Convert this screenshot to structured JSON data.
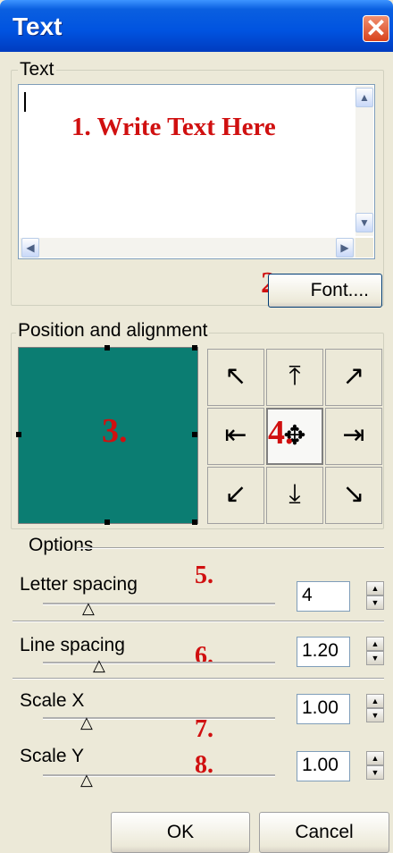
{
  "window": {
    "title": "Text",
    "close_glyph": "✕"
  },
  "text_group": {
    "label": "Text",
    "annotation": "1. Write Text Here",
    "font_button": "Font....",
    "font_marker": "2."
  },
  "position_group": {
    "label": "Position and alignment",
    "preview_marker": "3.",
    "grid_marker": "4.",
    "preview_color": "#0b7d72",
    "alignment_glyphs": [
      "↖",
      "⤒",
      "↗",
      "⇤",
      "✥",
      "⇥",
      "↙",
      "⤓",
      "↘"
    ]
  },
  "options_group": {
    "label": "Options",
    "letter_spacing": {
      "label": "Letter spacing",
      "value": "4",
      "marker": "5."
    },
    "line_spacing": {
      "label": "Line spacing",
      "value": "1.20",
      "marker": "6."
    },
    "scale_x": {
      "label": "Scale X",
      "value": "1.00",
      "marker": "7."
    },
    "scale_y": {
      "label": "Scale Y",
      "value": "1.00",
      "marker": "8."
    }
  },
  "footer": {
    "ok": "OK",
    "cancel": "Cancel"
  }
}
